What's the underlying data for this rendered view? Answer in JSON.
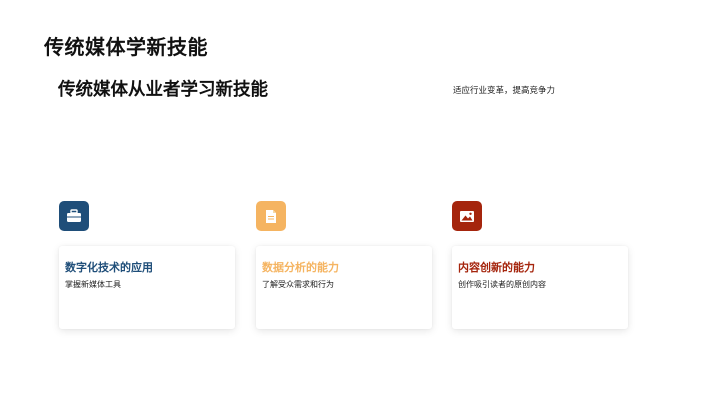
{
  "slide": {
    "title": "传统媒体学新技能",
    "subtitle": "传统媒体从业者学习新技能",
    "tagline": "适应行业变革，提高竞争力"
  },
  "cards": [
    {
      "title": "数字化技术的应用",
      "desc": "掌握新媒体工具",
      "icon": "briefcase-icon",
      "color": "#1f4e79"
    },
    {
      "title": "数据分析的能力",
      "desc": "了解受众需求和行为",
      "icon": "document-icon",
      "color": "#f5b461"
    },
    {
      "title": "内容创新的能力",
      "desc": "创作吸引读者的原创内容",
      "icon": "image-icon",
      "color": "#a5250d"
    }
  ]
}
